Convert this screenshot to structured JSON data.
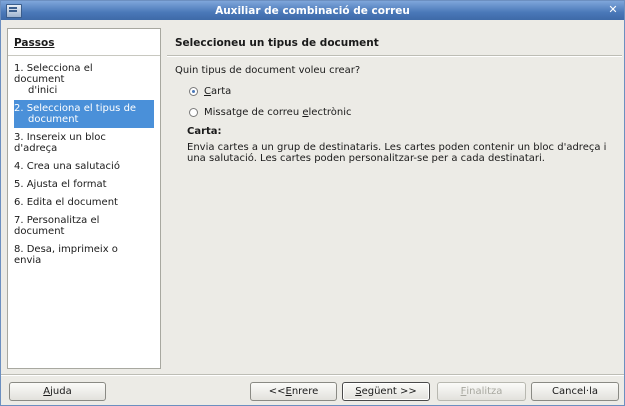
{
  "window": {
    "title": "Auxiliar de combinació de correu"
  },
  "steps": {
    "title": "Passos",
    "items": [
      {
        "label": "1. Selecciona el document",
        "label2": "d'inici"
      },
      {
        "label": "2. Selecciona el tipus de",
        "label2": "document"
      },
      {
        "label": "3. Insereix un bloc d'adreça"
      },
      {
        "label": "4. Crea una salutació"
      },
      {
        "label": "5. Ajusta el format"
      },
      {
        "label": "6. Edita el document"
      },
      {
        "label": "7. Personalitza el document"
      },
      {
        "label": "8. Desa, imprimeix o envia"
      }
    ],
    "active_index": 1
  },
  "main": {
    "title": "Seleccioneu un tipus de document",
    "question": "Quin tipus de document voleu crear?",
    "options": [
      {
        "label_pre": "",
        "label_u": "C",
        "label_post": "arta",
        "checked": true
      },
      {
        "label_pre": "Missatge de correu ",
        "label_u": "e",
        "label_post": "lectrònic",
        "checked": false
      }
    ],
    "desc_title": "Carta:",
    "desc": "Envia cartes a un grup de destinataris. Les cartes poden contenir un bloc d'adreça i una salutació. Les cartes poden personalitzar-se per a cada destinatari."
  },
  "buttons": {
    "help": {
      "u": "A",
      "rest": "juda"
    },
    "back": {
      "pre": "<< ",
      "u": "E",
      "rest": "nrere"
    },
    "next": {
      "pre": "",
      "u": "S",
      "rest": "egüent >>"
    },
    "finish": {
      "u": "F",
      "rest": "inalitza"
    },
    "cancel": {
      "label": "Cancel·la"
    }
  },
  "colors": {
    "titlebar": "#4a78b8",
    "selection": "#4a90d9"
  }
}
